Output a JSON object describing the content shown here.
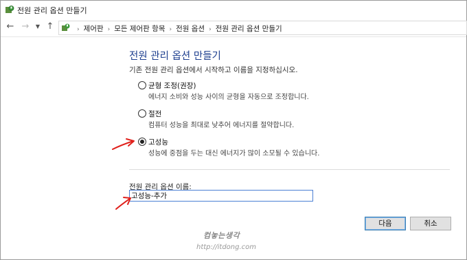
{
  "window": {
    "title": "전원 관리 옵션 만들기"
  },
  "nav": {
    "back_icon": "arrow-left-icon",
    "forward_icon": "arrow-right-icon",
    "recent_icon": "chevron-down-icon",
    "up_icon": "arrow-up-icon"
  },
  "breadcrumb": [
    "제어판",
    "모든 제어판 항목",
    "전원 옵션",
    "전원 관리 옵션 만들기"
  ],
  "main": {
    "heading": "전원 관리 옵션 만들기",
    "description": "기존 전원 관리 옵션에서 시작하고 이름을 지정하십시오.",
    "options": [
      {
        "label": "균형 조정(권장)",
        "sub": "에너지 소비와 성능 사이의 균형을 자동으로 조정합니다.",
        "checked": false
      },
      {
        "label": "절전",
        "sub": "컴퓨터 성능을 최대로 낮추어 에너지를 절약합니다.",
        "checked": false
      },
      {
        "label": "고성능",
        "sub": "성능에 중점을 두는 대신 에너지가 많이 소모될 수 있습니다.",
        "checked": true
      }
    ],
    "name_label": "전원 관리 옵션 이름:",
    "name_value": "고성능-추가"
  },
  "buttons": {
    "next": "다음",
    "cancel": "취소"
  },
  "watermark": {
    "title": "컴놓는생각",
    "url": "http://itdong.com"
  },
  "colors": {
    "heading": "#1e3f8f",
    "annotation_arrow": "#e0201b"
  }
}
